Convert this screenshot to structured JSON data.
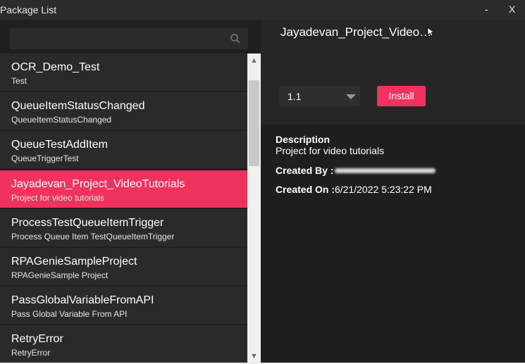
{
  "window": {
    "title": "Package List",
    "minimize_label": "-",
    "close_label": "X"
  },
  "search": {
    "placeholder": "",
    "icon": "search-icon"
  },
  "packages": [
    {
      "name": "OCR_Demo_Test",
      "description": "Test",
      "selected": false
    },
    {
      "name": "QueueItemStatusChanged",
      "description": "QueueItemStatusChanged",
      "selected": false
    },
    {
      "name": "QueueTestAddItem",
      "description": "QueueTriggerTest",
      "selected": false
    },
    {
      "name": "Jayadevan_Project_VideoTutorials",
      "description": "Project for video tutorials",
      "selected": true
    },
    {
      "name": "ProcessTestQueueItemTrigger",
      "description": "Process Queue Item TestQueueItemTrigger",
      "selected": false
    },
    {
      "name": "RPAGenieSampleProject",
      "description": "RPAGenieSample Project",
      "selected": false
    },
    {
      "name": "PassGlobalVariableFromAPI",
      "description": "Pass Global Variable From API",
      "selected": false
    },
    {
      "name": "RetryError",
      "description": "RetryError",
      "selected": false
    }
  ],
  "scrollbar": {
    "up_glyph": "▲",
    "down_glyph": "▼"
  },
  "detail": {
    "title": "Jayadevan_Project_Video…",
    "version": "1.1",
    "install_label": "Install",
    "description_heading": "Description",
    "description": "Project for video tutorials",
    "created_by_label": "Created By :",
    "created_on_label": "Created On :",
    "created_on": "6/21/2022 5:23:22 PM"
  },
  "colors": {
    "accent": "#f0325f",
    "background": "#1e1e1e"
  }
}
